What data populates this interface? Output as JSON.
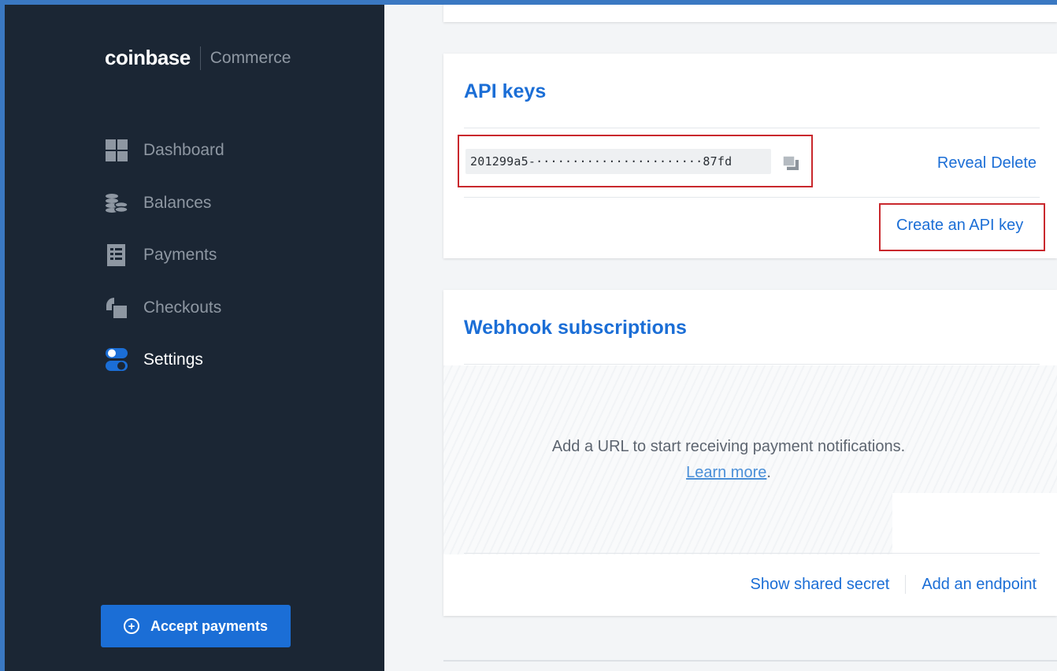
{
  "brand": {
    "name": "coinbase",
    "product": "Commerce"
  },
  "sidebar": {
    "items": [
      {
        "label": "Dashboard",
        "icon": "dashboard-icon",
        "active": false
      },
      {
        "label": "Balances",
        "icon": "coins-icon",
        "active": false
      },
      {
        "label": "Payments",
        "icon": "document-icon",
        "active": false
      },
      {
        "label": "Checkouts",
        "icon": "checkout-icon",
        "active": false
      },
      {
        "label": "Settings",
        "icon": "toggle-icon",
        "active": true
      }
    ],
    "accept_button": "Accept payments"
  },
  "api_keys": {
    "title": "API keys",
    "key_value": "201299a5-·······················87fd",
    "reveal": "Reveal",
    "delete": "Delete",
    "create": "Create an API key"
  },
  "webhooks": {
    "title": "Webhook subscriptions",
    "empty_text": "Add a URL to start receiving payment notifications.",
    "learn_more": "Learn more",
    "learn_more_suffix": ".",
    "show_secret": "Show shared secret",
    "add_endpoint": "Add an endpoint"
  },
  "colors": {
    "sidebar_bg": "#1b2634",
    "accent": "#1b6ed6",
    "highlight_border": "#c9282d"
  }
}
